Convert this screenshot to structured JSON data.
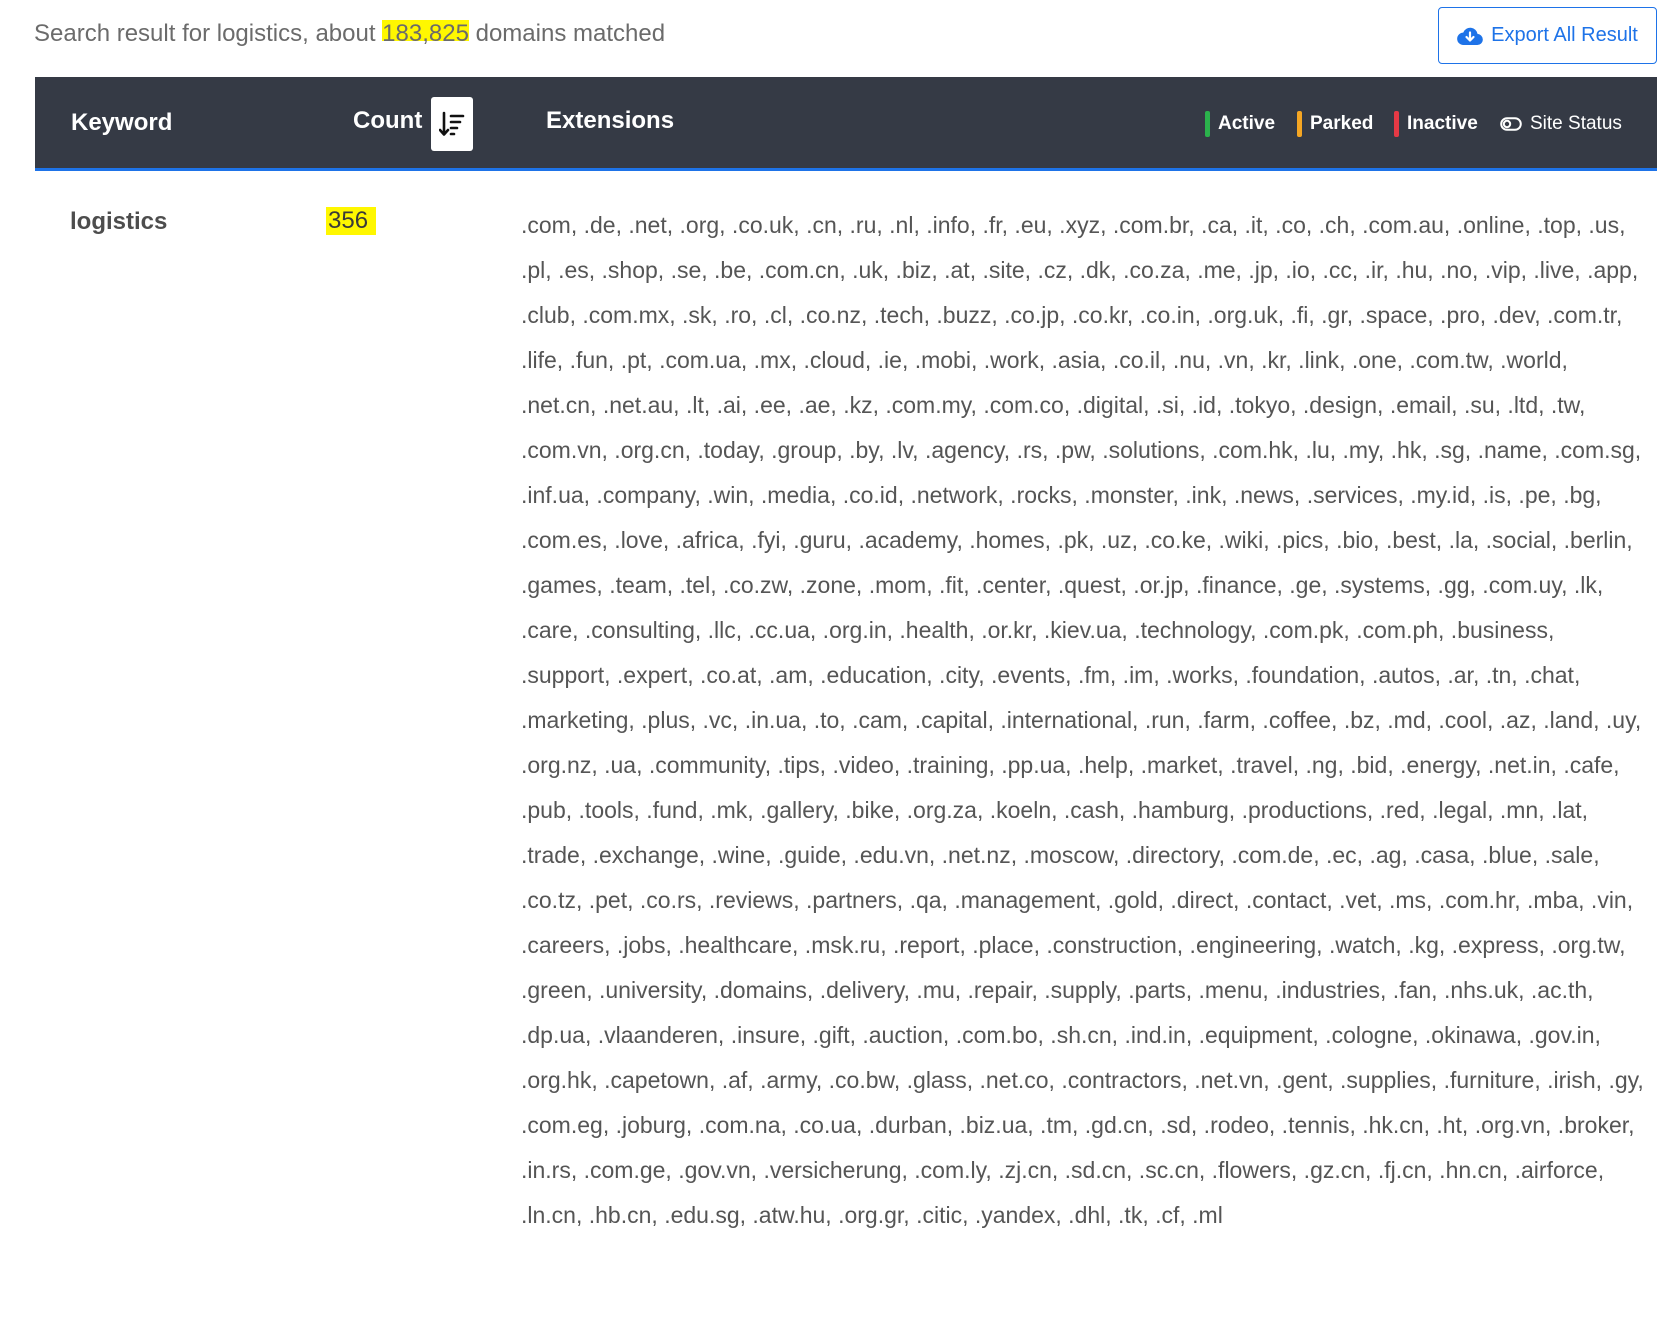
{
  "summary": {
    "prefix": "Search result for logistics, about ",
    "count": "183,825",
    "suffix": " domains matched"
  },
  "export_button": {
    "label": "Export All Result",
    "icon": "cloud-download-icon",
    "color": "#1e73e8"
  },
  "table": {
    "headers": {
      "keyword": "Keyword",
      "count": "Count",
      "extensions": "Extensions"
    },
    "sort_icon": "sort-descending-icon",
    "legend": [
      {
        "label": "Active",
        "color": "#2bb24c"
      },
      {
        "label": "Parked",
        "color": "#f5a623"
      },
      {
        "label": "Inactive",
        "color": "#e53945"
      }
    ],
    "site_status": {
      "label": "Site Status",
      "icon": "toggle-icon"
    },
    "rows": [
      {
        "keyword": "logistics",
        "count": "356",
        "extensions": ".com, .de, .net, .org, .co.uk, .cn, .ru, .nl, .info, .fr, .eu, .xyz, .com.br, .ca, .it, .co, .ch, .com.au, .online, .top, .us, .pl, .es, .shop, .se, .be, .com.cn, .uk, .biz, .at, .site, .cz, .dk, .co.za, .me, .jp, .io, .cc, .ir, .hu, .no, .vip, .live, .app, .club, .com.mx, .sk, .ro, .cl, .co.nz, .tech, .buzz, .co.jp, .co.kr, .co.in, .org.uk, .fi, .gr, .space, .pro, .dev, .com.tr, .life, .fun, .pt, .com.ua, .mx, .cloud, .ie, .mobi, .work, .asia, .co.il, .nu, .vn, .kr, .link, .one, .com.tw, .world, .net.cn, .net.au, .lt, .ai, .ee, .ae, .kz, .com.my, .com.co, .digital, .si, .id, .tokyo, .design, .email, .su, .ltd, .tw, .com.vn, .org.cn, .today, .group, .by, .lv, .agency, .rs, .pw, .solutions, .com.hk, .lu, .my, .hk, .sg, .name, .com.sg, .inf.ua, .company, .win, .media, .co.id, .network, .rocks, .monster, .ink, .news, .services, .my.id, .is, .pe, .bg, .com.es, .love, .africa, .fyi, .guru, .academy, .homes, .pk, .uz, .co.ke, .wiki, .pics, .bio, .best, .la, .social, .berlin, .games, .team, .tel, .co.zw, .zone, .mom, .fit, .center, .quest, .or.jp, .finance, .ge, .systems, .gg, .com.uy, .lk, .care, .consulting, .llc, .cc.ua, .org.in, .health, .or.kr, .kiev.ua, .technology, .com.pk, .com.ph, .business, .support, .expert, .co.at, .am, .education, .city, .events, .fm, .im, .works, .foundation, .autos, .ar, .tn, .chat, .marketing, .plus, .vc, .in.ua, .to, .cam, .capital, .international, .run, .farm, .coffee, .bz, .md, .cool, .az, .land, .uy, .org.nz, .ua, .community, .tips, .video, .training, .pp.ua, .help, .market, .travel, .ng, .bid, .energy, .net.in, .cafe, .pub, .tools, .fund, .mk, .gallery, .bike, .org.za, .koeln, .cash, .hamburg, .productions, .red, .legal, .mn, .lat, .trade, .exchange, .wine, .guide, .edu.vn, .net.nz, .moscow, .directory, .com.de, .ec, .ag, .casa, .blue, .sale, .co.tz, .pet, .co.rs, .reviews, .partners, .qa, .management, .gold, .direct, .contact, .vet, .ms, .com.hr, .mba, .vin, .careers, .jobs, .healthcare, .msk.ru, .report, .place, .construction, .engineering, .watch, .kg, .express, .org.tw, .green, .university, .domains, .delivery, .mu, .repair, .supply, .parts, .menu, .industries, .fan, .nhs.uk, .ac.th, .dp.ua, .vlaanderen, .insure, .gift, .auction, .com.bo, .sh.cn, .ind.in, .equipment, .cologne, .okinawa, .gov.in, .org.hk, .capetown, .af, .army, .co.bw, .glass, .net.co, .contractors, .net.vn, .gent, .supplies, .furniture, .irish, .gy, .com.eg, .joburg, .com.na, .co.ua, .durban, .biz.ua, .tm, .gd.cn, .sd, .rodeo, .tennis, .hk.cn, .ht, .org.vn, .broker, .in.rs, .com.ge, .gov.vn, .versicherung, .com.ly, .zj.cn, .sd.cn, .sc.cn, .flowers, .gz.cn, .fj.cn, .hn.cn, .airforce, .ln.cn, .hb.cn, .edu.sg, .atw.hu, .org.gr, .citic, .yandex, .dhl, .tk, .cf, .ml"
      }
    ]
  },
  "colors": {
    "header_bg": "#353a45",
    "accent": "#1e73e8",
    "highlight": "#fff700"
  }
}
